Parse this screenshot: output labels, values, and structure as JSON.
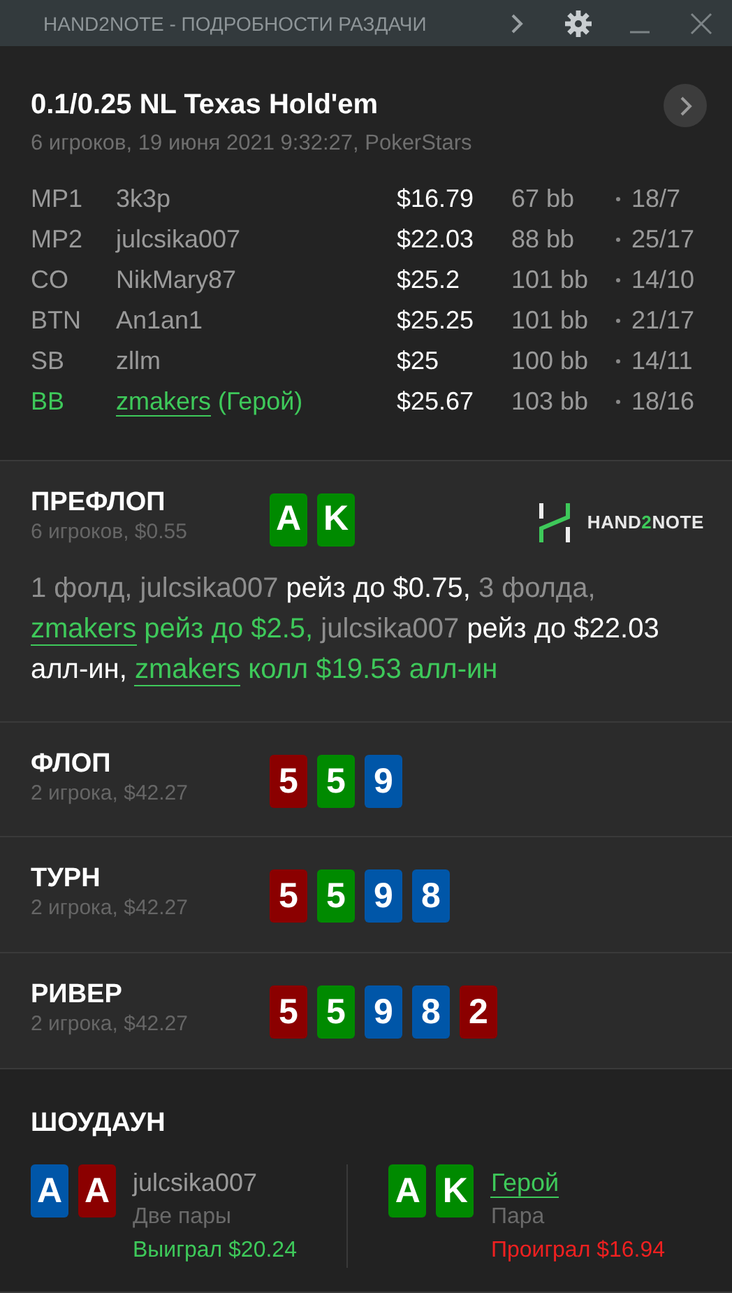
{
  "window": {
    "title": "HAND2NOTE - ПОДРОБНОСТИ РАЗДАЧИ"
  },
  "hand": {
    "title": "0.1/0.25 NL Texas Hold'em",
    "subtitle": "6 игроков, 19 июня 2021 9:32:27, PokerStars"
  },
  "players": [
    {
      "position": "MP1",
      "name": "3k3p",
      "hero": false,
      "stack": "$16.79",
      "bb": "67 bb",
      "stats": "18/7"
    },
    {
      "position": "MP2",
      "name": "julcsika007",
      "hero": false,
      "stack": "$22.03",
      "bb": "88 bb",
      "stats": "25/17"
    },
    {
      "position": "CO",
      "name": "NikMary87",
      "hero": false,
      "stack": "$25.2",
      "bb": "101 bb",
      "stats": "14/10"
    },
    {
      "position": "BTN",
      "name": "An1an1",
      "hero": false,
      "stack": "$25.25",
      "bb": "101 bb",
      "stats": "21/17"
    },
    {
      "position": "SB",
      "name": "zllm",
      "hero": false,
      "stack": "$25",
      "bb": "100 bb",
      "stats": "14/11"
    },
    {
      "position": "BB",
      "name": "zmakers",
      "note": "(Герой)",
      "hero": true,
      "stack": "$25.67",
      "bb": "103 bb",
      "stats": "18/16"
    }
  ],
  "logo": {
    "parts": [
      {
        "text": "HAND",
        "kind": "plain"
      },
      {
        "text": "2",
        "kind": "accent"
      },
      {
        "text": "NOTE",
        "kind": "plain"
      }
    ]
  },
  "streets": [
    {
      "name": "ПРЕФЛОП",
      "info": "6 игроков, $0.55",
      "cards": [
        {
          "rank": "A",
          "color": "#008a00"
        },
        {
          "rank": "K",
          "color": "#008a00"
        }
      ],
      "actions": [
        {
          "text": "1 фолд, julcsika007 ",
          "kind": "muted"
        },
        {
          "text": "рейз до $0.75, ",
          "kind": "action"
        },
        {
          "text": "3 фолда, ",
          "kind": "muted"
        },
        {
          "text": "zmakers",
          "kind": "hero-link"
        },
        {
          "text": " рейз до $2.5, ",
          "kind": "hero"
        },
        {
          "text": "julcsika007 ",
          "kind": "muted"
        },
        {
          "text": "рейз до $22.03 алл-ин, ",
          "kind": "action"
        },
        {
          "text": "zmakers",
          "kind": "hero-link"
        },
        {
          "text": " колл $19.53 алл-ин",
          "kind": "hero"
        }
      ]
    },
    {
      "name": "ФЛОП",
      "info": "2 игрока, $42.27",
      "cards": [
        {
          "rank": "5",
          "color": "#8b0000"
        },
        {
          "rank": "5",
          "color": "#008a00"
        },
        {
          "rank": "9",
          "color": "#0056a8"
        }
      ]
    },
    {
      "name": "ТУРН",
      "info": "2 игрока, $42.27",
      "cards": [
        {
          "rank": "5",
          "color": "#8b0000"
        },
        {
          "rank": "5",
          "color": "#008a00"
        },
        {
          "rank": "9",
          "color": "#0056a8"
        },
        {
          "rank": "8",
          "color": "#0056a8"
        }
      ]
    },
    {
      "name": "РИВЕР",
      "info": "2 игрока, $42.27",
      "cards": [
        {
          "rank": "5",
          "color": "#8b0000"
        },
        {
          "rank": "5",
          "color": "#008a00"
        },
        {
          "rank": "9",
          "color": "#0056a8"
        },
        {
          "rank": "8",
          "color": "#0056a8"
        },
        {
          "rank": "2",
          "color": "#8b0000"
        }
      ]
    }
  ],
  "showdown": {
    "title": "ШОУДАУН",
    "hands": [
      {
        "name": "julcsika007",
        "hero": false,
        "combo": "Две пары",
        "result": "Выиграл $20.24",
        "won": true,
        "cards": [
          {
            "rank": "A",
            "color": "#0056a8"
          },
          {
            "rank": "A",
            "color": "#8b0000"
          }
        ]
      },
      {
        "name": "Герой",
        "hero": true,
        "combo": "Пара",
        "result": "Проиграл $16.94",
        "won": false,
        "cards": [
          {
            "rank": "A",
            "color": "#008a00"
          },
          {
            "rank": "K",
            "color": "#008a00"
          }
        ]
      }
    ]
  }
}
